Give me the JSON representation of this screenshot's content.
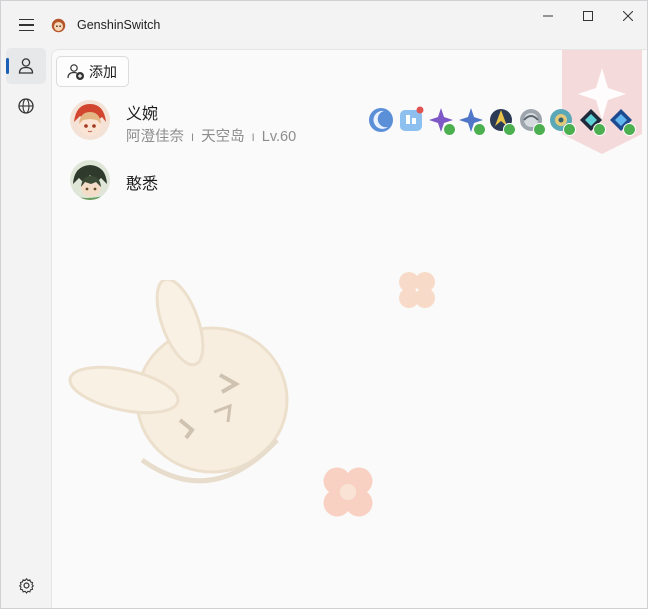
{
  "app": {
    "title": "GenshinSwitch"
  },
  "toolbar": {
    "add_label": "添加"
  },
  "accounts": [
    {
      "name": "义婉",
      "server": "阿澄佳奈",
      "world": "天空岛",
      "level": "Lv.60",
      "separator": "I"
    },
    {
      "name": "憨悉"
    }
  ],
  "status_icons": [
    "moon-icon",
    "phone-icon",
    "star-icon",
    "star-icon",
    "compass-icon",
    "orb-icon",
    "gear-orb-icon",
    "teal-diamond-icon",
    "blue-diamond-icon"
  ],
  "colors": {
    "accent": "#1a5fb4",
    "check": "#4caf50",
    "watermark": "#f2cfcf"
  }
}
